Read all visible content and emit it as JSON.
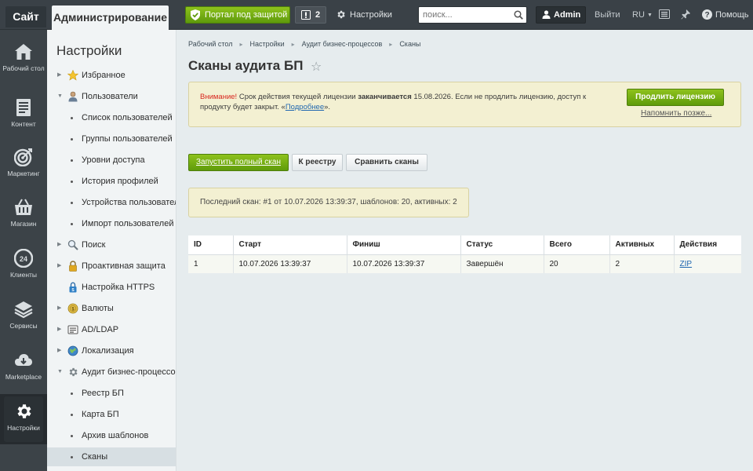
{
  "topbar": {
    "site_tab": "Сайт",
    "admin_tab": "Администрирование",
    "protect_button": "Портал под защитой",
    "notifications_count": "2",
    "settings_label": "Настройки",
    "search_placeholder": "поиск...",
    "user_name": "Admin",
    "logout_label": "Выйти",
    "language": "RU",
    "help_label": "Помощь",
    "accent_color": "#6aa615"
  },
  "rail": {
    "items": [
      {
        "label": "Рабочий стол",
        "icon": "house-icon"
      },
      {
        "label": "Контент",
        "icon": "document-icon"
      },
      {
        "label": "Маркетинг",
        "icon": "target-icon"
      },
      {
        "label": "Магазин",
        "icon": "basket-icon"
      },
      {
        "label": "Клиенты",
        "icon": "clients-24-icon",
        "badge": "24"
      },
      {
        "label": "Сервисы",
        "icon": "layers-icon"
      },
      {
        "label": "Marketplace",
        "icon": "cloud-download-icon"
      },
      {
        "label": "Настройки",
        "icon": "gear-icon",
        "active": true
      }
    ]
  },
  "menu": {
    "title": "Настройки",
    "items": [
      {
        "label": "Избранное",
        "icon": "star-icon",
        "arrow": "right"
      },
      {
        "label": "Пользователи",
        "icon": "user-icon",
        "arrow": "down"
      },
      {
        "label": "Список пользователей",
        "sub": true
      },
      {
        "label": "Группы пользователей",
        "sub": true
      },
      {
        "label": "Уровни доступа",
        "sub": true
      },
      {
        "label": "История профилей",
        "sub": true
      },
      {
        "label": "Устройства пользователей",
        "sub": true
      },
      {
        "label": "Импорт пользователей",
        "sub": true
      },
      {
        "label": "Поиск",
        "icon": "magnifier-icon",
        "arrow": "right"
      },
      {
        "label": "Проактивная защита",
        "icon": "lock-icon",
        "arrow": "right"
      },
      {
        "label": "Настройка HTTPS",
        "icon": "https-lock-icon",
        "arrow": "none"
      },
      {
        "label": "Валюты",
        "icon": "coin-icon",
        "arrow": "right"
      },
      {
        "label": "AD/LDAP",
        "icon": "folder-icon",
        "arrow": "right"
      },
      {
        "label": "Локализация",
        "icon": "globe-icon",
        "arrow": "right"
      },
      {
        "label": "Аудит бизнес-процессов",
        "icon": "gear-small-icon",
        "arrow": "down"
      },
      {
        "label": "Реестр БП",
        "sub": true
      },
      {
        "label": "Карта БП",
        "sub": true
      },
      {
        "label": "Архив шаблонов",
        "sub": true
      },
      {
        "label": "Сканы",
        "sub": true,
        "active": true
      }
    ]
  },
  "breadcrumb": [
    "Рабочий стол",
    "Настройки",
    "Аудит бизнес-процессов",
    "Сканы"
  ],
  "page_title": "Сканы аудита БП",
  "warning": {
    "label": "Внимание!",
    "text_1": " Срок действия текущей лицензии ",
    "bold": "заканчивается",
    "text_2": " 15.08.2026. Если не продлить лицензию, доступ к продукту будет закрыт. «",
    "link": "Подробнее",
    "text_3": "».",
    "renew_button": "Продлить лицензию",
    "remind_link": "Напомнить позже..."
  },
  "actions": {
    "run_scan": "Запустить полный скан",
    "registry": "К реестру",
    "compare": "Сравнить сканы"
  },
  "last_scan": "Последний скан: #1 от 10.07.2026 13:39:37, шаблонов: 20, активных: 2",
  "table": {
    "headers": [
      "ID",
      "Старт",
      "Финиш",
      "Статус",
      "Всего",
      "Активных",
      "Действия"
    ],
    "rows": [
      [
        "1",
        "10.07.2026 13:39:37",
        "10.07.2026 13:39:37",
        "Завершён",
        "20",
        "2",
        "ZIP"
      ]
    ]
  }
}
